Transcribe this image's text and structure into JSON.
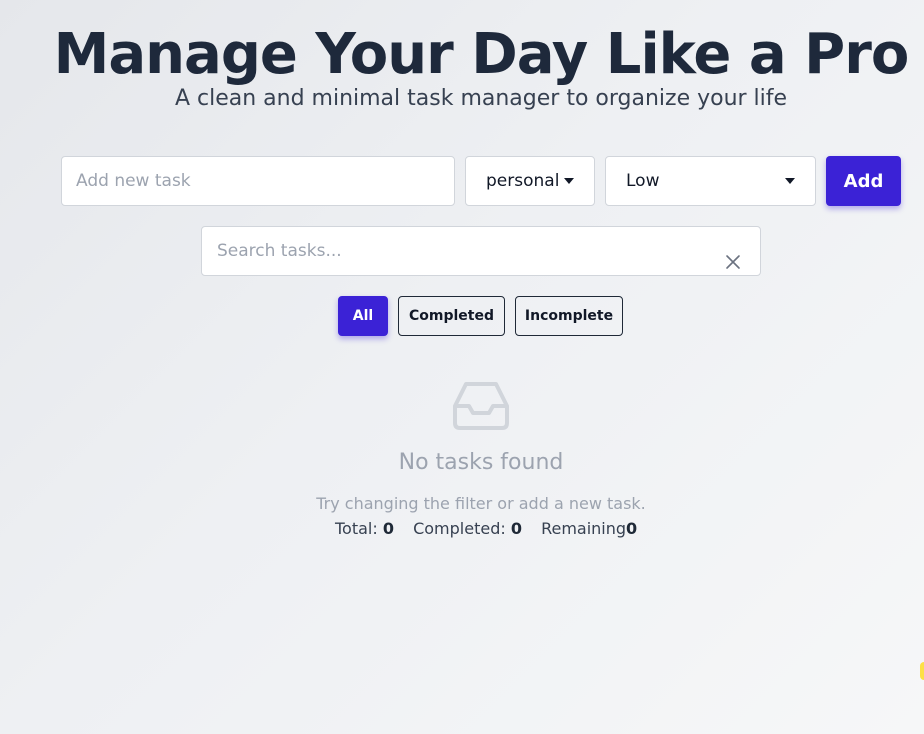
{
  "header": {
    "title": "Manage Your Day Like a Pro",
    "subtitle": "A clean and minimal task manager to organize your life"
  },
  "form": {
    "task_placeholder": "Add new task",
    "task_value": "",
    "category_selected": "personal",
    "priority_selected": "Low",
    "add_label": "Add"
  },
  "search": {
    "placeholder": "Search tasks...",
    "value": "",
    "clear_icon": "close-icon"
  },
  "filters": {
    "active": "All",
    "items": [
      {
        "label": "All"
      },
      {
        "label": "Completed"
      },
      {
        "label": "Incomplete"
      }
    ]
  },
  "empty_state": {
    "icon": "inbox-icon",
    "title": "No tasks found",
    "hint": "Try changing the filter or add a new task."
  },
  "stats": {
    "total_label": "Total:",
    "total": "0",
    "completed_label": "Completed:",
    "completed": "0",
    "remaining_label": "Remaining",
    "remaining": "0"
  },
  "colors": {
    "accent": "#3b22d6",
    "heading": "#1e293b",
    "muted": "#9ca3af",
    "background": "#eceef1"
  }
}
